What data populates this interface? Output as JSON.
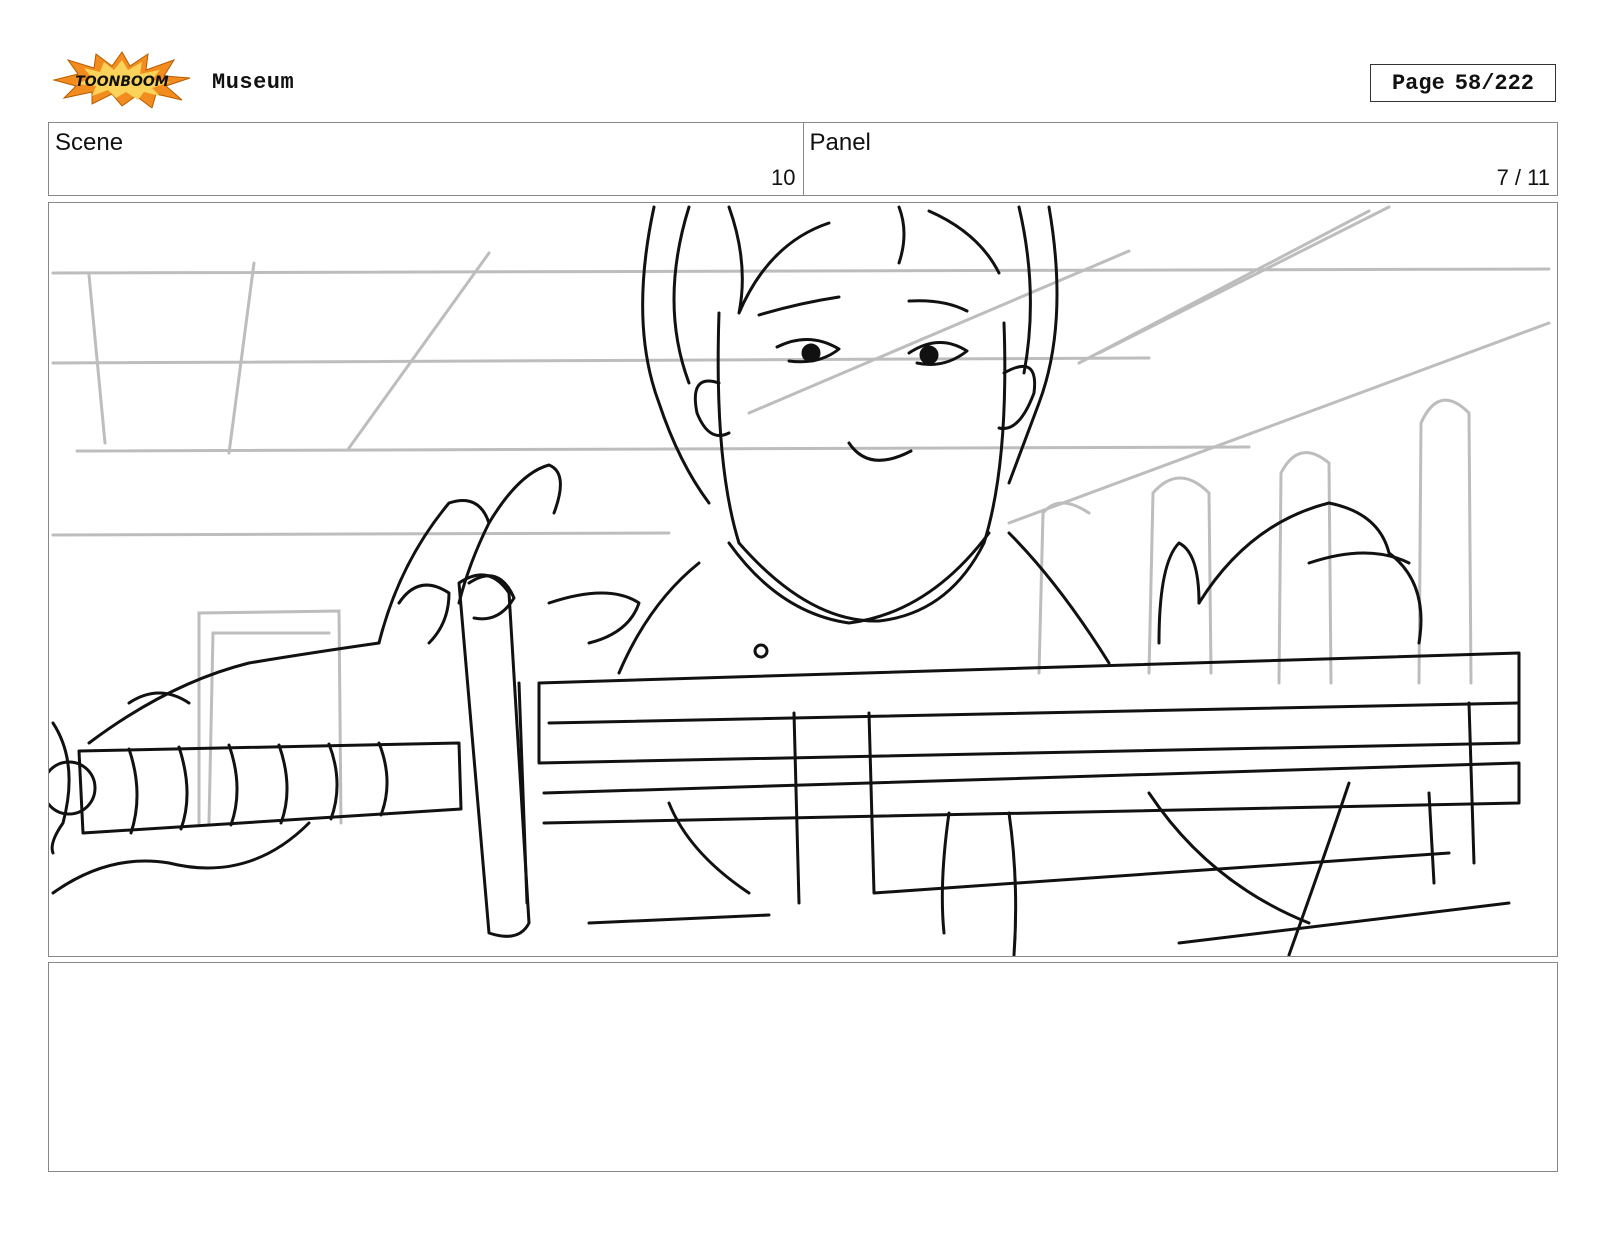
{
  "header": {
    "logo_text": "TOONBOOM",
    "project_title": "Museum",
    "page_label": "Page",
    "page_value": "58/222"
  },
  "scene": {
    "label": "Scene",
    "value": "10"
  },
  "panel": {
    "label": "Panel",
    "value": "7 / 11"
  },
  "colors": {
    "logo_burst": "#f28c1e",
    "logo_inner": "#fbd35a",
    "sketch_line": "#111111",
    "background_sketch": "#bdbdbd"
  },
  "notes": ""
}
